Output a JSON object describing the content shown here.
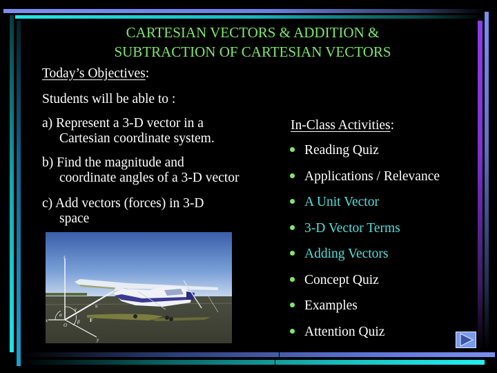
{
  "slide": {
    "title_line1": "CARTESIAN VECTORS & ADDITION &",
    "title_line2": "SUBTRACTION OF CARTESIAN VECTORS",
    "objectives": {
      "heading": "Today’s Objectives",
      "heading_suffix": ":",
      "intro": "Students will be able to :",
      "items": [
        {
          "line1": "a) Represent a 3-D vector in a",
          "line2": "Cartesian coordinate system."
        },
        {
          "line1": "b) Find the magnitude and",
          "line2": "coordinate angles of a 3-D vector"
        },
        {
          "line1": "c) Add vectors (forces) in 3-D",
          "line2": "space"
        }
      ]
    },
    "activities": {
      "heading": "In-Class Activities",
      "heading_suffix": ":",
      "items": [
        {
          "label": "Reading Quiz",
          "highlighted": false
        },
        {
          "label": "Applications / Relevance",
          "highlighted": false
        },
        {
          "label": "A Unit Vector",
          "highlighted": true
        },
        {
          "label": "3-D Vector Terms",
          "highlighted": true
        },
        {
          "label": "Adding Vectors",
          "highlighted": true
        },
        {
          "label": "Concept Quiz",
          "highlighted": false
        },
        {
          "label": "Examples",
          "highlighted": false
        },
        {
          "label": "Attention Quiz",
          "highlighted": false
        }
      ]
    },
    "photo": {
      "description": "Cessna airplane on runway with 3-D force vector diagram overlay",
      "axis_labels": {
        "z": "z",
        "x": "x",
        "y": "y",
        "origin": "O",
        "force": "F",
        "unit": "u",
        "alpha": "α",
        "beta": "β",
        "gamma": "γ"
      }
    },
    "next_button": {
      "icon": "play-triangle-icon"
    }
  },
  "colors": {
    "background": "#000000",
    "title": "#7ee86a",
    "text": "#ffffff",
    "highlight": "#4ee0dc",
    "bullet": "#7ee86a",
    "accent_blue": "#7b8ff0",
    "accent_cyan": "#22e6e6",
    "accent_purple": "#8a3ee6"
  }
}
